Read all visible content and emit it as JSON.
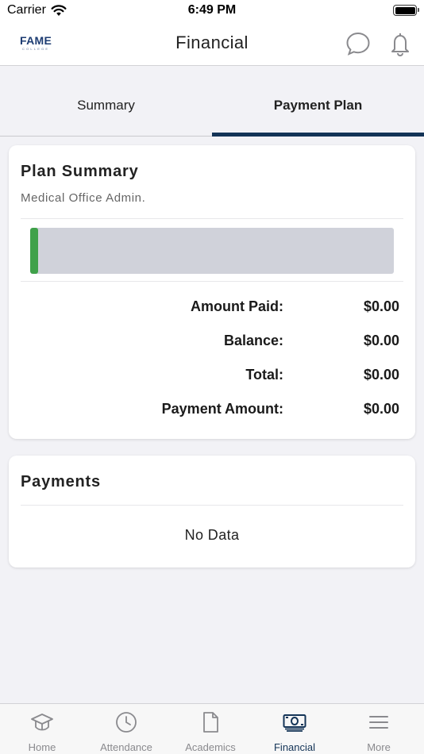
{
  "status_bar": {
    "carrier": "Carrier",
    "time": "6:49 PM"
  },
  "header": {
    "logo_text": "FAME",
    "logo_subtext": "COLLEGE",
    "title": "Financial",
    "chat_icon": "chat-bubble-icon",
    "bell_icon": "bell-icon"
  },
  "tabs": [
    {
      "label": "Summary",
      "active": false
    },
    {
      "label": "Payment Plan",
      "active": true
    }
  ],
  "plan_summary": {
    "title": "Plan Summary",
    "program": "Medical Office Admin.",
    "progress_fraction": 0,
    "rows": [
      {
        "label": "Amount Paid:",
        "value": "$0.00"
      },
      {
        "label": "Balance:",
        "value": "$0.00"
      },
      {
        "label": "Total:",
        "value": "$0.00"
      },
      {
        "label": "Payment Amount:",
        "value": "$0.00"
      }
    ]
  },
  "payments": {
    "title": "Payments",
    "empty_text": "No Data"
  },
  "tab_bar": [
    {
      "label": "Home",
      "icon": "graduation-cap-icon",
      "active": false
    },
    {
      "label": "Attendance",
      "icon": "clock-icon",
      "active": false
    },
    {
      "label": "Academics",
      "icon": "document-icon",
      "active": false
    },
    {
      "label": "Financial",
      "icon": "money-icon",
      "active": true
    },
    {
      "label": "More",
      "icon": "menu-icon",
      "active": false
    }
  ],
  "colors": {
    "brand_navy": "#143457",
    "progress_green": "#3fa14a",
    "track_gray": "#d0d2da",
    "inactive_gray": "#8a8a8e"
  }
}
